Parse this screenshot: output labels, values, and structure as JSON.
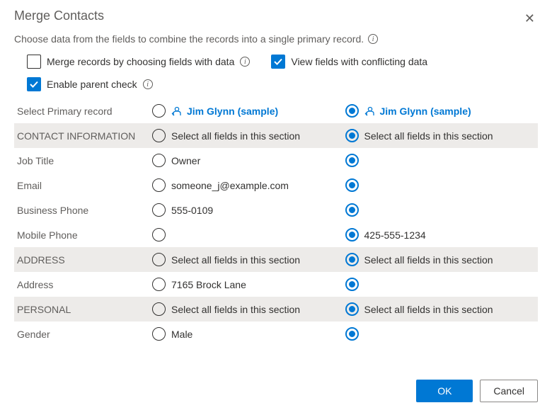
{
  "dialog": {
    "title": "Merge Contacts",
    "subtitle": "Choose data from the fields to combine the records into a single primary record.",
    "close_glyph": "✕"
  },
  "options": {
    "merge_by_fields": {
      "label": "Merge records by choosing fields with data",
      "checked": false
    },
    "view_conflicts": {
      "label": "View fields with conflicting data",
      "checked": true
    },
    "enable_parent_check": {
      "label": "Enable parent check",
      "checked": true
    }
  },
  "table": {
    "select_primary_label": "Select Primary record",
    "section_select_all": "Select all fields in this section",
    "record_a": {
      "name": "Jim Glynn (sample)",
      "primary": false
    },
    "record_b": {
      "name": "Jim Glynn (sample)",
      "primary": true
    },
    "sections": [
      {
        "header": "CONTACT INFORMATION",
        "rows": [
          {
            "label": "Job Title",
            "a": "Owner",
            "b": ""
          },
          {
            "label": "Email",
            "a": "someone_j@example.com",
            "b": ""
          },
          {
            "label": "Business Phone",
            "a": "555-0109",
            "b": ""
          },
          {
            "label": "Mobile Phone",
            "a": "",
            "b": "425-555-1234"
          }
        ]
      },
      {
        "header": "ADDRESS",
        "rows": [
          {
            "label": "Address",
            "a": "7165 Brock Lane",
            "b": ""
          }
        ]
      },
      {
        "header": "PERSONAL",
        "rows": [
          {
            "label": "Gender",
            "a": "Male",
            "b": ""
          }
        ]
      }
    ]
  },
  "footer": {
    "ok": "OK",
    "cancel": "Cancel"
  }
}
